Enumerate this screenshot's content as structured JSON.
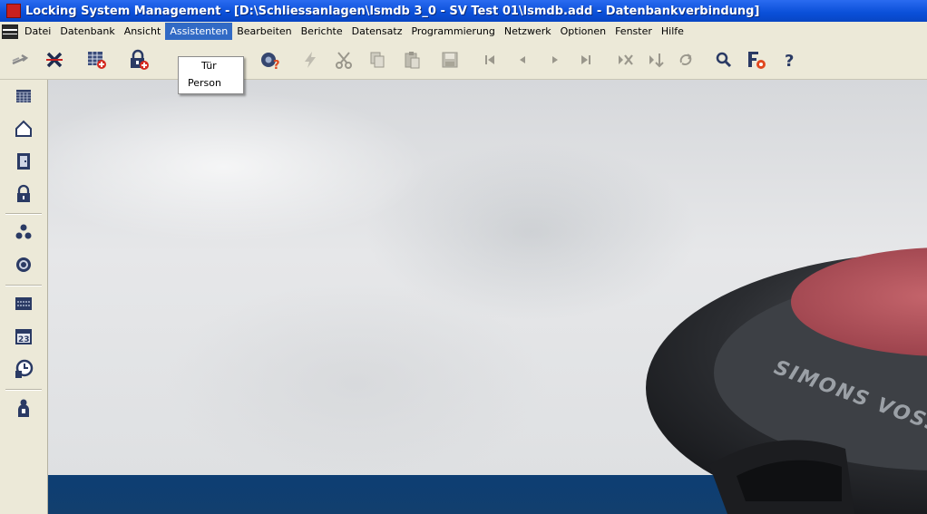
{
  "window": {
    "title": "Locking System Management - [D:\\Schliessanlagen\\lsmdb 3_0 - SV Test 01\\lsmdb.add - Datenbankverbindung]"
  },
  "menubar": {
    "items": [
      {
        "label": "Datei"
      },
      {
        "label": "Datenbank"
      },
      {
        "label": "Ansicht"
      },
      {
        "label": "Assistenten"
      },
      {
        "label": "Bearbeiten"
      },
      {
        "label": "Berichte"
      },
      {
        "label": "Datensatz"
      },
      {
        "label": "Programmierung"
      },
      {
        "label": "Netzwerk"
      },
      {
        "label": "Optionen"
      },
      {
        "label": "Fenster"
      },
      {
        "label": "Hilfe"
      }
    ],
    "active": "Assistenten"
  },
  "dropdown": {
    "items": [
      {
        "label": "Tür"
      },
      {
        "label": "Person"
      }
    ]
  },
  "toolbar": {
    "buttons": [
      "swap-arrow-icon",
      "delete-x-icon",
      "add-record-icon",
      "add-lock-icon",
      "programming-icon",
      "lightning-icon",
      "cut-icon",
      "copy-icon",
      "paste-icon",
      "save-icon",
      "first-record-icon",
      "previous-record-icon",
      "next-record-icon",
      "last-record-icon",
      "delete-record-icon",
      "insert-record-icon",
      "refresh-icon",
      "search-icon",
      "filter-settings-icon",
      "help-icon"
    ]
  },
  "sidebar": {
    "buttons": [
      "matrix-icon",
      "home-icon",
      "door-icon",
      "padlock-icon",
      "groups-icon",
      "target-icon",
      "time-zone-icon",
      "calendar-icon",
      "clock-icon",
      "person-icon"
    ],
    "calendar_day": "23"
  },
  "hero": {
    "brand_text": "SIMONS VOSS"
  },
  "colors": {
    "titlebar": "#0a4fd8",
    "menu_highlight": "#316ac5",
    "chrome": "#ece9d8",
    "bottom_band": "#0d3e73",
    "device_red": "#b5525a"
  }
}
